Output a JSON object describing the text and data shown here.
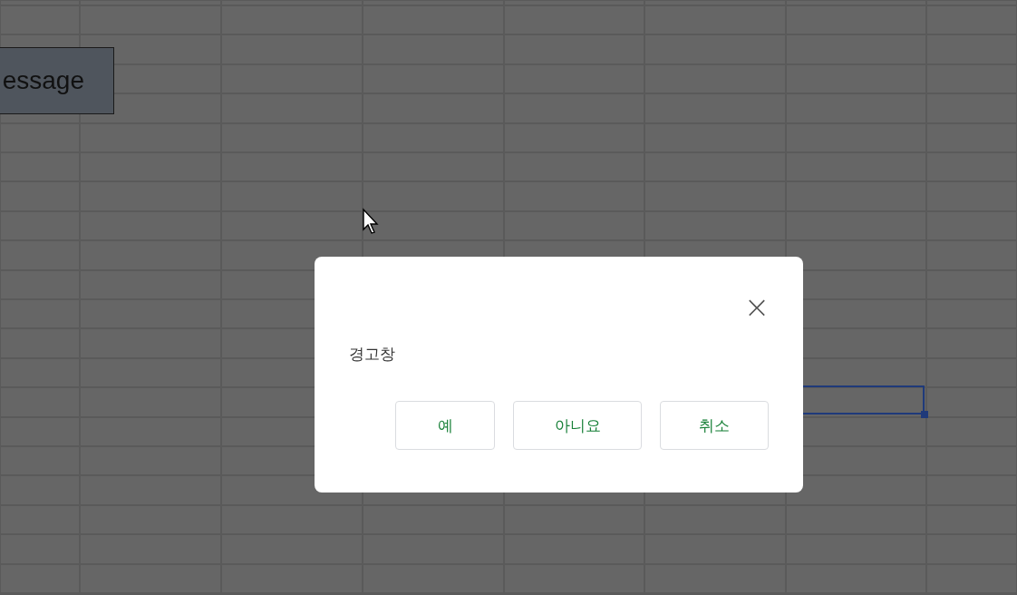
{
  "sheet": {
    "drawing_button": {
      "label": "essage"
    }
  },
  "dialog": {
    "close": "×",
    "message": "경고창",
    "buttons": [
      {
        "label": "예"
      },
      {
        "label": "아니요"
      },
      {
        "label": "취소"
      }
    ]
  }
}
